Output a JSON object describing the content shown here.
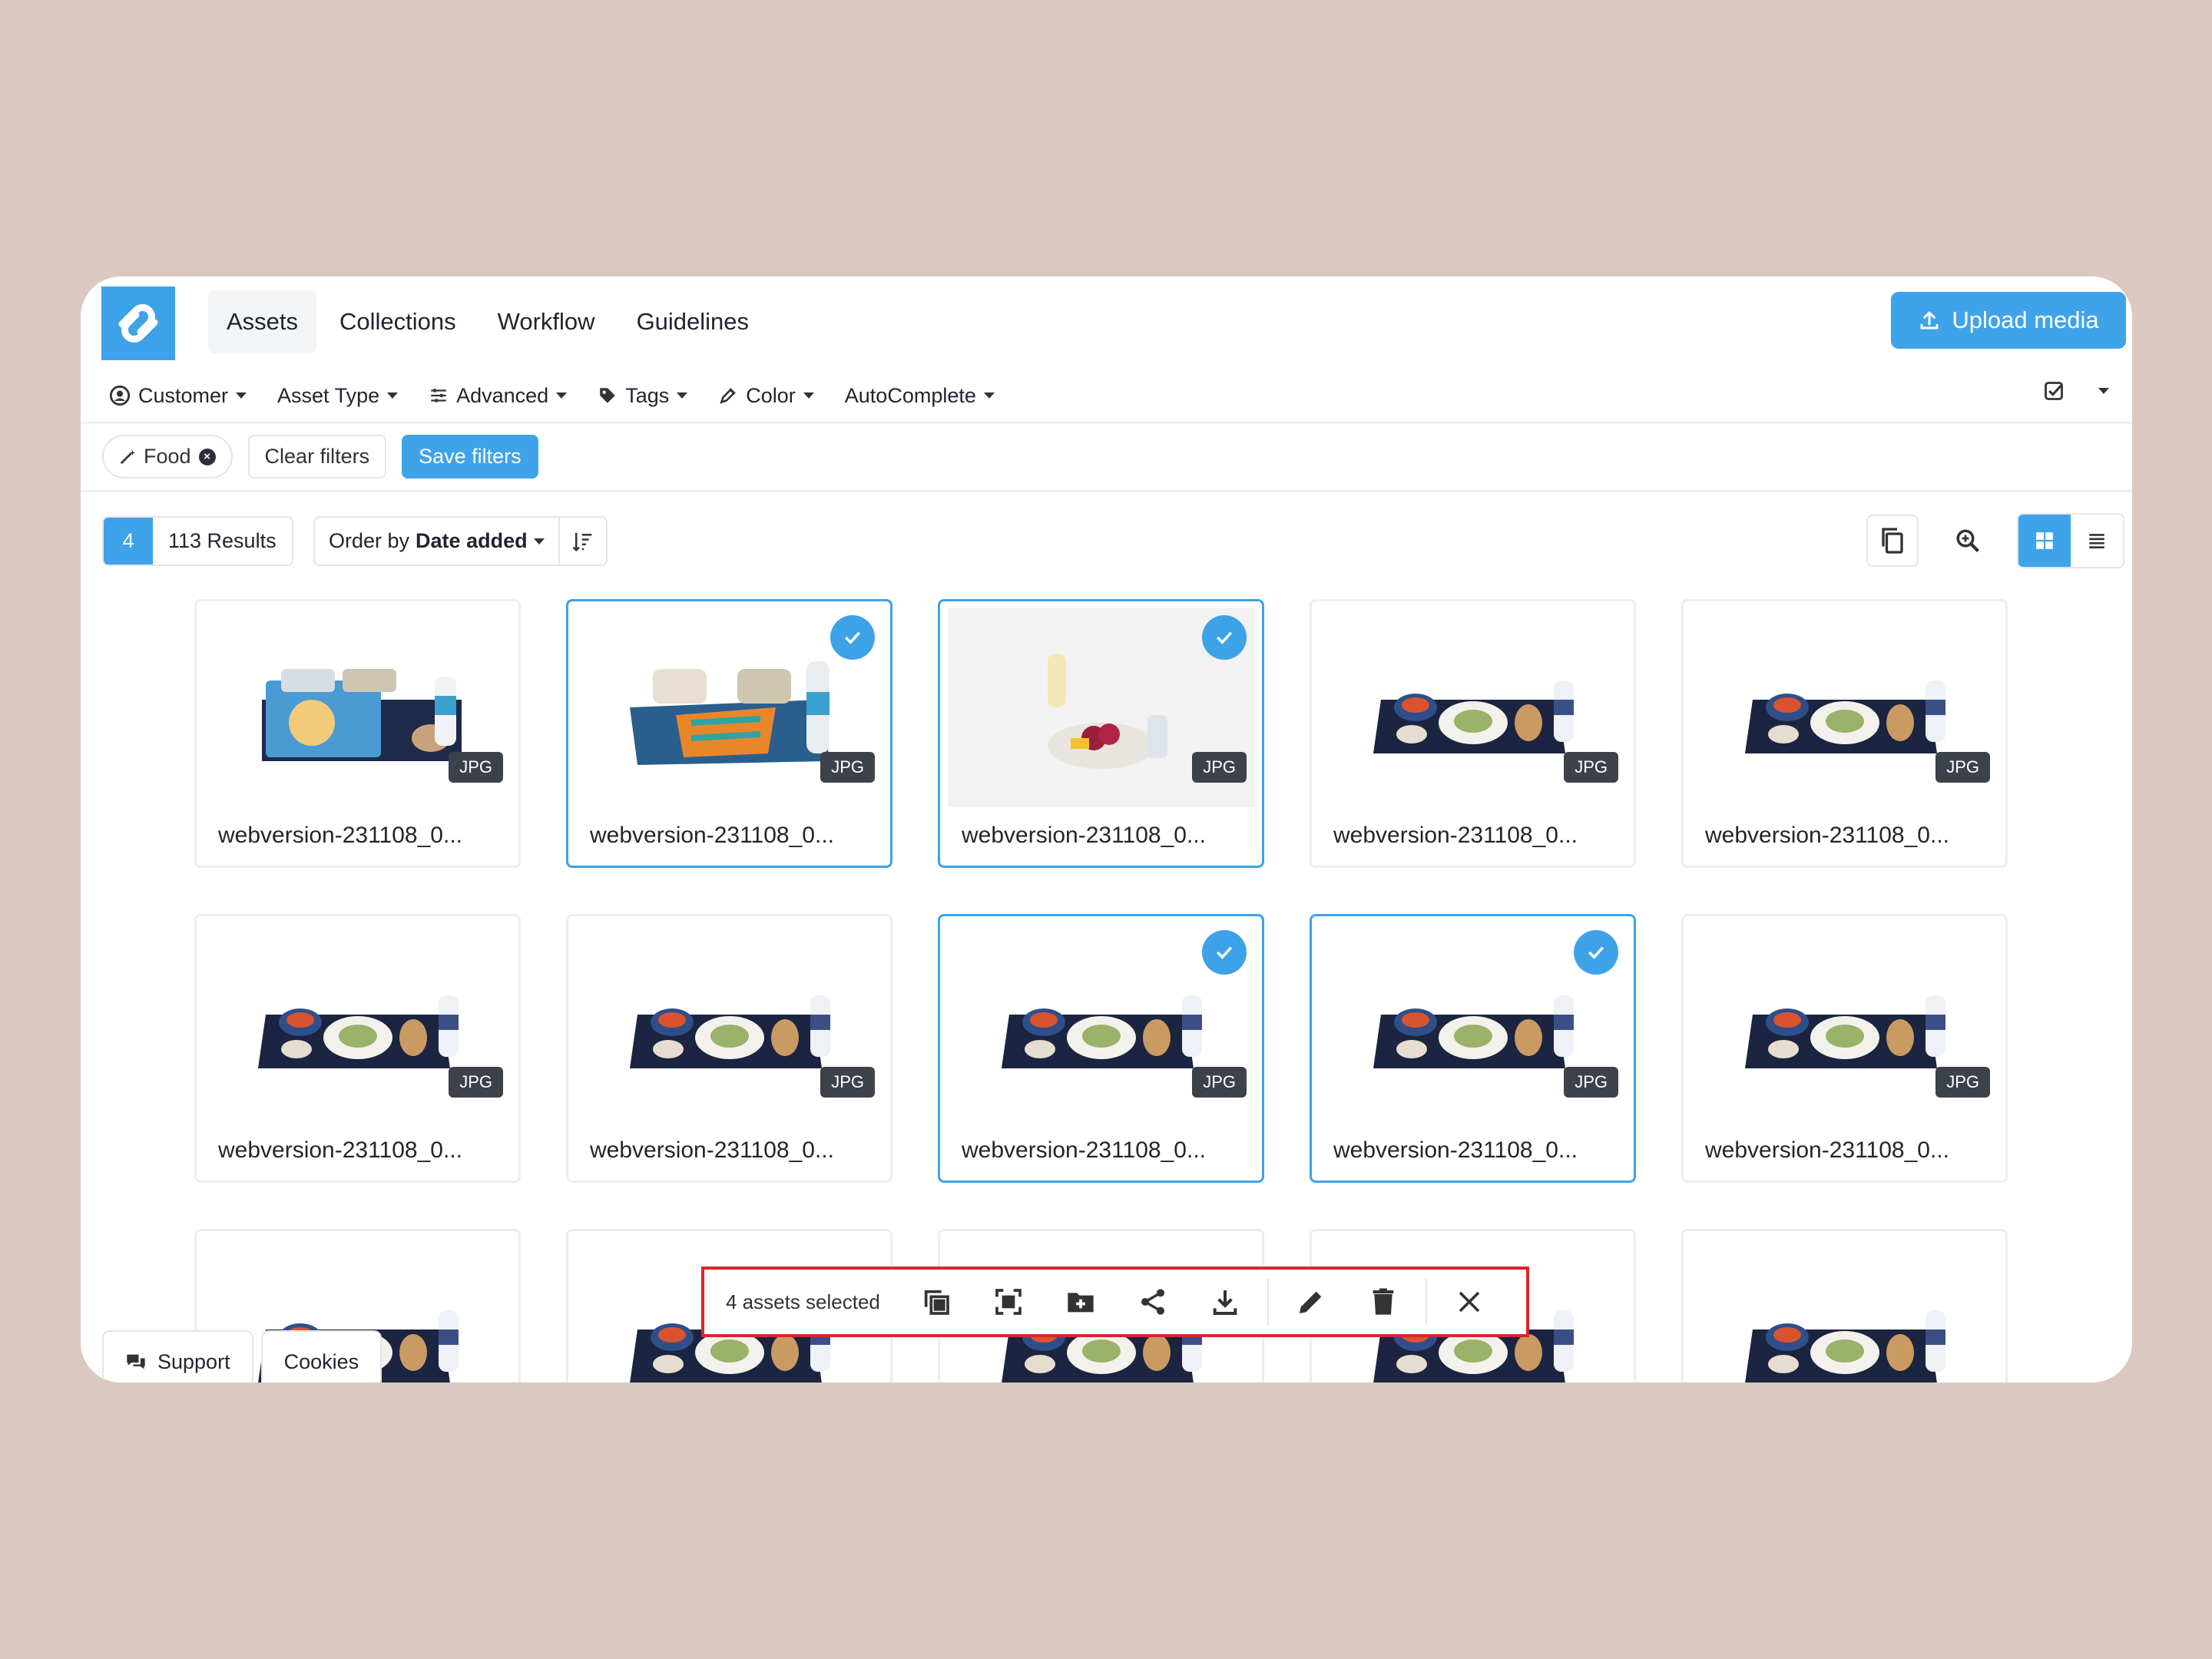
{
  "nav": {
    "logo": "logo",
    "tabs": [
      {
        "label": "Assets",
        "active": true
      },
      {
        "label": "Collections"
      },
      {
        "label": "Workflow"
      },
      {
        "label": "Guidelines"
      }
    ],
    "upload_label": "Upload media"
  },
  "filters": {
    "items": [
      {
        "label": "Customer",
        "icon": "user-circle-icon"
      },
      {
        "label": "Asset Type",
        "icon": ""
      },
      {
        "label": "Advanced",
        "icon": "sliders-icon"
      },
      {
        "label": "Tags",
        "icon": "tag-icon"
      },
      {
        "label": "Color",
        "icon": "eyedropper-icon"
      },
      {
        "label": "AutoComplete",
        "icon": ""
      }
    ]
  },
  "chips": {
    "active_filter": "Food",
    "clear_label": "Clear filters",
    "save_label": "Save filters"
  },
  "results": {
    "selected_count": "4",
    "count_label": "113 Results",
    "order_prefix": "Order by",
    "order_value": "Date added"
  },
  "assets": [
    {
      "name": "webversion-231108_0...",
      "type": "JPG",
      "selected": false
    },
    {
      "name": "webversion-231108_0...",
      "type": "JPG",
      "selected": true
    },
    {
      "name": "webversion-231108_0...",
      "type": "JPG",
      "selected": true
    },
    {
      "name": "webversion-231108_0...",
      "type": "JPG",
      "selected": false
    },
    {
      "name": "webversion-231108_0...",
      "type": "JPG",
      "selected": false
    },
    {
      "name": "webversion-231108_0...",
      "type": "JPG",
      "selected": false
    },
    {
      "name": "webversion-231108_0...",
      "type": "JPG",
      "selected": false
    },
    {
      "name": "webversion-231108_0...",
      "type": "JPG",
      "selected": true
    },
    {
      "name": "webversion-231108_0...",
      "type": "JPG",
      "selected": true
    },
    {
      "name": "webversion-231108_0...",
      "type": "JPG",
      "selected": false
    }
  ],
  "bulk_bar": {
    "label": "4 assets selected",
    "actions": [
      "copy-icon",
      "select-frame-icon",
      "add-to-folder-icon",
      "share-icon",
      "download-icon",
      "edit-icon",
      "delete-icon",
      "close-icon"
    ]
  },
  "bottom": {
    "support_label": "Support",
    "cookies_label": "Cookies"
  },
  "colors": {
    "accent": "#3fa3ea",
    "highlight": "#d8262c",
    "background": "#dbc8c1"
  }
}
